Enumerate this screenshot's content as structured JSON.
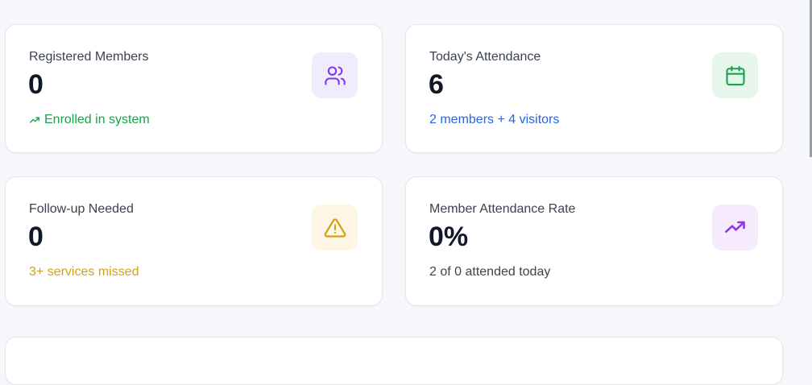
{
  "cards": [
    {
      "label": "Registered Members",
      "value": "0",
      "sub": "Enrolled in system",
      "sub_color": "#16a34a",
      "icon": "users-icon",
      "icon_color": "#7c3aed",
      "icon_bg": "#f0ebfd"
    },
    {
      "label": "Today's Attendance",
      "value": "6",
      "sub": "2 members + 4 visitors",
      "sub_color": "#2563eb",
      "icon": "calendar-icon",
      "icon_color": "#16a34a",
      "icon_bg": "#e6f6ea"
    },
    {
      "label": "Follow-up Needed",
      "value": "0",
      "sub": "3+ services missed",
      "sub_color": "#d4a017",
      "icon": "warning-icon",
      "icon_color": "#d4a017",
      "icon_bg": "#fdf6e4"
    },
    {
      "label": "Member Attendance Rate",
      "value": "0%",
      "sub": "2 of 0 attended today",
      "sub_color": "#3b4350",
      "icon": "trending-up-icon",
      "icon_color": "#9333ea",
      "icon_bg": "#f5ebfd"
    }
  ]
}
